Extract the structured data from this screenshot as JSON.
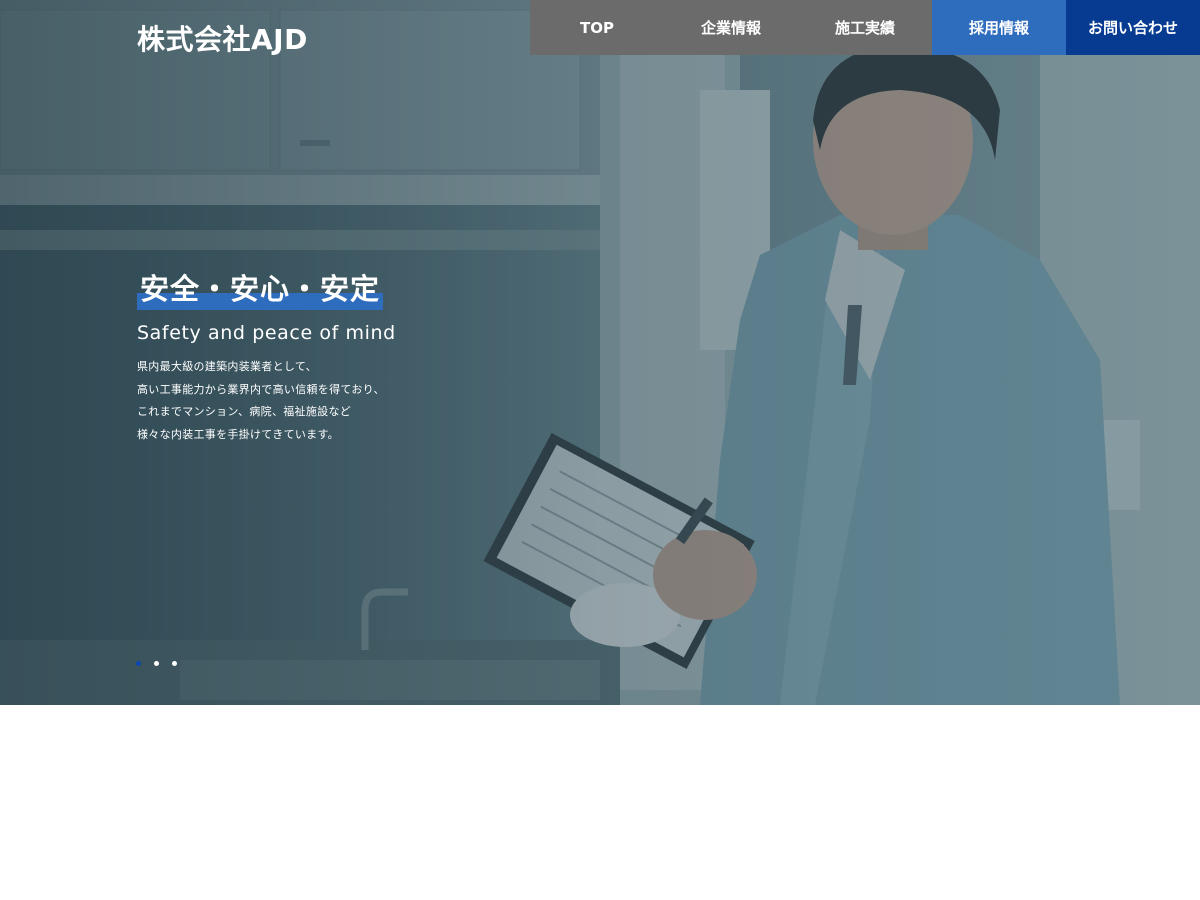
{
  "header": {
    "logo": "株式会社AJD",
    "nav": [
      {
        "label": "TOP"
      },
      {
        "label": "企業情報"
      },
      {
        "label": "施工実績"
      },
      {
        "label": "採用情報"
      },
      {
        "label": "お問い合わせ"
      }
    ]
  },
  "hero": {
    "headline": "安全・安心・安定",
    "subheadline": "Safety and peace of mind",
    "body_lines": [
      "県内最大級の建築内装業者として、",
      "高い工事能力から業界内で高い信頼を得ており、",
      "これまでマンション、病院、福祉施設など",
      "様々な内装工事を手掛けてきています。"
    ],
    "slide_count": 3,
    "active_slide": 1
  },
  "colors": {
    "nav_gray": "#6b6b6b",
    "nav_recruit": "#2e6cbe",
    "nav_contact": "#063b91",
    "headline_highlight": "#2e6cbe",
    "active_dot": "#0b49b0"
  }
}
